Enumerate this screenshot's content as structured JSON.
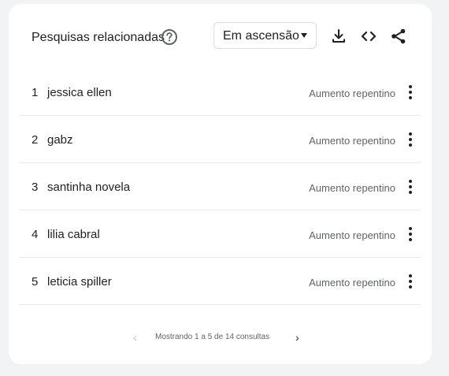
{
  "widget": {
    "title": "Pesquisas relacionadas",
    "help_icon": "help-circle-icon",
    "filter": {
      "selected": "Em ascensão",
      "icon": "dropdown-arrow-icon"
    },
    "toolbar": {
      "download_icon": "download-icon",
      "embed_icon": "embed-code-icon",
      "share_icon": "share-icon"
    }
  },
  "rows": [
    {
      "rank": "1",
      "term": "jessica ellen",
      "value": "Aumento repentino"
    },
    {
      "rank": "2",
      "term": "gabz",
      "value": "Aumento repentino"
    },
    {
      "rank": "3",
      "term": "santinha novela",
      "value": "Aumento repentino"
    },
    {
      "rank": "4",
      "term": "lilia cabral",
      "value": "Aumento repentino"
    },
    {
      "rank": "5",
      "term": "leticia spiller",
      "value": "Aumento repentino"
    }
  ],
  "pagination": {
    "label": "Mostrando 1 a 5 de 14 consultas",
    "prev_glyph": "‹",
    "next_glyph": "›"
  },
  "colors": {
    "background": "#f1f3f4",
    "card": "#ffffff",
    "text": "#202124",
    "muted": "#5f6368",
    "divider": "#e8eaed"
  }
}
